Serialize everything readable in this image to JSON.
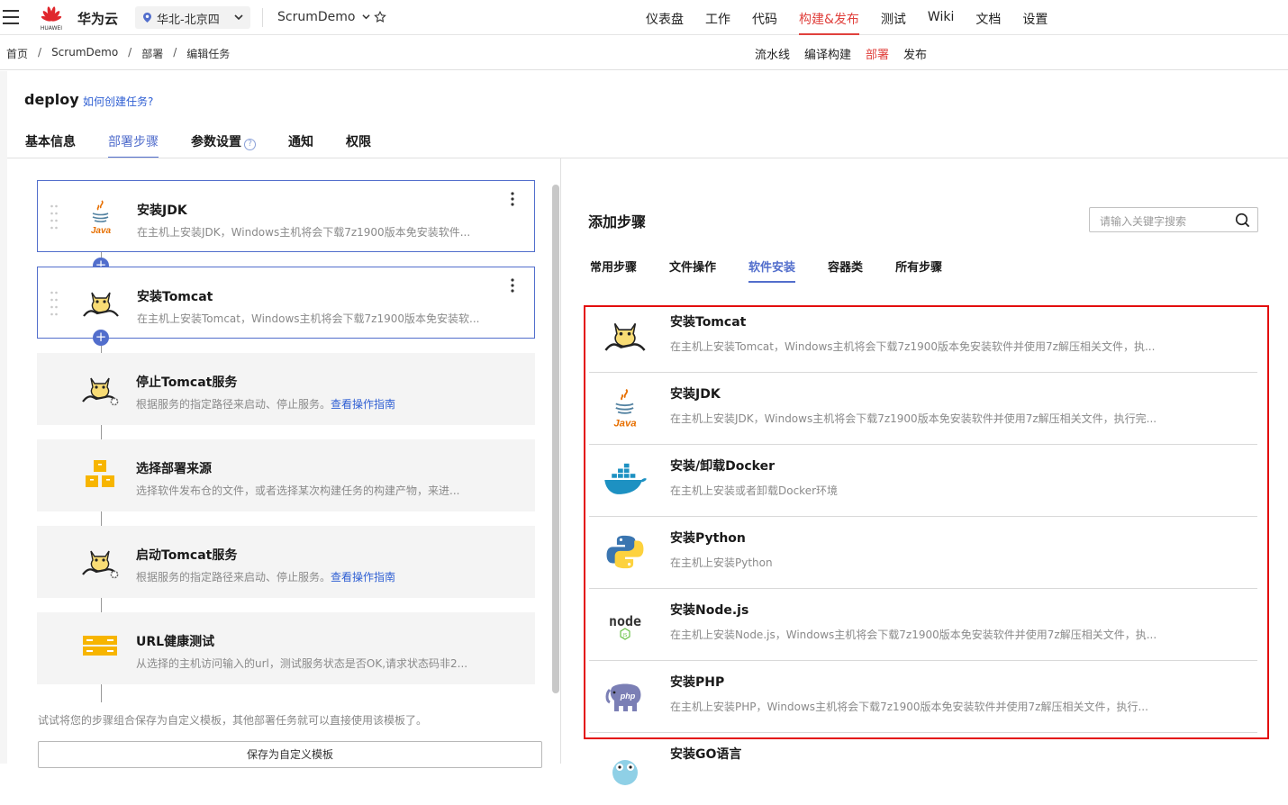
{
  "header": {
    "brand": "华为云",
    "logo_text": "HUAWEI",
    "region": "华北-北京四",
    "project": "ScrumDemo",
    "nav": [
      "仪表盘",
      "工作",
      "代码",
      "构建&发布",
      "测试",
      "Wiki",
      "文档",
      "设置"
    ],
    "nav_active": "构建&发布"
  },
  "subbar": {
    "breadcrumb": [
      "首页",
      "ScrumDemo",
      "部署",
      "编辑任务"
    ],
    "breadcrumb_sep": "/",
    "nav": [
      "流水线",
      "编译构建",
      "部署",
      "发布"
    ],
    "nav_active": "部署"
  },
  "task": {
    "title": "deploy",
    "howto": "如何创建任务?",
    "tabs": [
      "基本信息",
      "部署步骤",
      "参数设置",
      "通知",
      "权限"
    ],
    "active_tab": "部署步骤",
    "help_glyph": "?"
  },
  "steps": [
    {
      "name": "安装JDK",
      "desc": "在主机上安装JDK，Windows主机将会下载7z1900版本免安装软件...",
      "icon": "java-icon"
    },
    {
      "name": "安装Tomcat",
      "desc": "在主机上安装Tomcat，Windows主机将会下载7z1900版本免安装软...",
      "icon": "tomcat-icon"
    },
    {
      "name": "停止Tomcat服务",
      "desc": "根据服务的指定路径来启动、停止服务。",
      "link": "查看操作指南",
      "icon": "tomcat-gear-icon"
    },
    {
      "name": "选择部署来源",
      "desc": "选择软件发布仓的文件，或者选择某次构建任务的构建产物，来进...",
      "icon": "boxes-icon"
    },
    {
      "name": "启动Tomcat服务",
      "desc": "根据服务的指定路径来启动、停止服务。",
      "link": "查看操作指南",
      "icon": "tomcat-gear-icon"
    },
    {
      "name": "URL健康测试",
      "desc": "从选择的主机访问输入的url，测试服务状态是否OK,请求状态码非2...",
      "icon": "server-icon"
    }
  ],
  "plus_glyph": "+",
  "left_footer": {
    "tip": "试试将您的步骤组合保存为自定义模板，其他部署任务就可以直接使用该模板了。",
    "save_button": "保存为自定义模板"
  },
  "add_panel": {
    "title": "添加步骤",
    "search_placeholder": "请输入关键字搜索",
    "tabs": [
      "常用步骤",
      "文件操作",
      "软件安装",
      "容器类",
      "所有步骤"
    ],
    "active_tab": "软件安装",
    "items": [
      {
        "name": "安装Tomcat",
        "desc": "在主机上安装Tomcat，Windows主机将会下载7z1900版本免安装软件并使用7z解压相关文件，执...",
        "icon": "tomcat-icon"
      },
      {
        "name": "安装JDK",
        "desc": "在主机上安装JDK，Windows主机将会下载7z1900版本免安装软件并使用7z解压相关文件，执行完...",
        "icon": "java-icon"
      },
      {
        "name": "安装/卸载Docker",
        "desc": "在主机上安装或者卸载Docker环境",
        "icon": "docker-icon"
      },
      {
        "name": "安装Python",
        "desc": "在主机上安装Python",
        "icon": "python-icon"
      },
      {
        "name": "安装Node.js",
        "desc": "在主机上安装Node.js，Windows主机将会下载7z1900版本免安装软件并使用7z解压相关文件，执...",
        "icon": "nodejs-icon"
      },
      {
        "name": "安装PHP",
        "desc": "在主机上安装PHP，Windows主机将会下载7z1900版本免安装软件并使用7z解压相关文件，执行...",
        "icon": "php-icon"
      },
      {
        "name": "安装GO语言",
        "desc": "",
        "icon": "go-icon"
      }
    ]
  },
  "icon_text": {
    "java": "Java",
    "php": "php",
    "nodejs": "node",
    "nodejs_badge": "JS"
  },
  "colors": {
    "accent": "#526ecc",
    "brand_red": "#e0413d",
    "highlight": "#e30e0e",
    "link": "#2f5fd3"
  }
}
